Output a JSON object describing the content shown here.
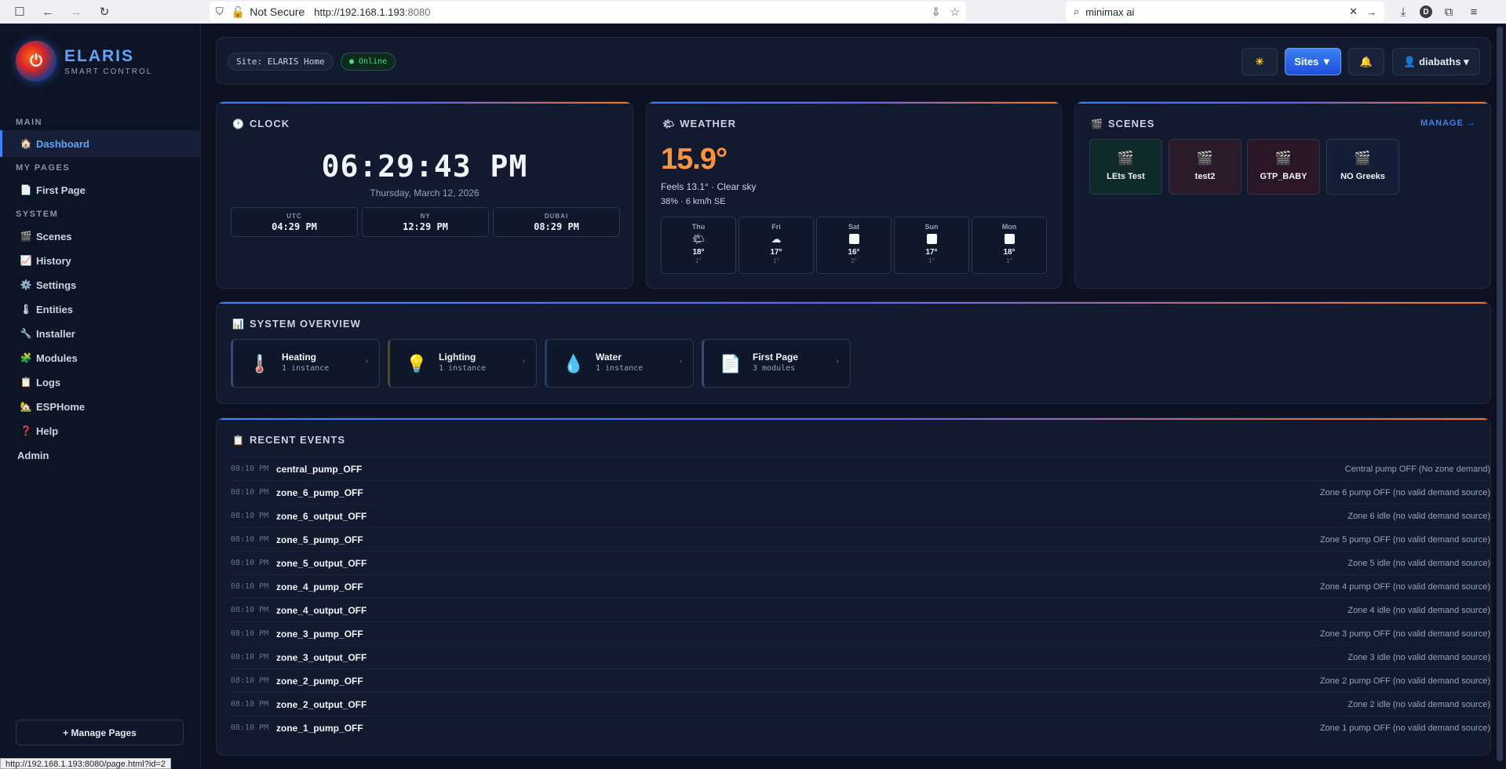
{
  "browser": {
    "security": "Not Secure",
    "url_host": "http://192.168.1.193",
    "url_port": ":8080",
    "search_query": "minimax ai",
    "profile_initial": "D",
    "status_url": "http://192.168.1.193:8080/page.html?id=2"
  },
  "brand": {
    "name": "ELARIS",
    "subtitle": "SMART CONTROL"
  },
  "sidebar": {
    "section_main": "MAIN",
    "section_pages": "MY PAGES",
    "section_system": "SYSTEM",
    "items": [
      {
        "icon": "🏠",
        "label": "Dashboard"
      },
      {
        "icon": "📄",
        "label": "First Page"
      },
      {
        "icon": "🎬",
        "label": "Scenes"
      },
      {
        "icon": "📈",
        "label": "History"
      },
      {
        "icon": "⚙️",
        "label": "Settings"
      },
      {
        "icon": "🌡",
        "label": "Entities"
      },
      {
        "icon": "🔧",
        "label": "Installer"
      },
      {
        "icon": "🧩",
        "label": "Modules"
      },
      {
        "icon": "📋",
        "label": "Logs"
      },
      {
        "icon": "🏡",
        "label": "ESPHome"
      },
      {
        "icon": "❓",
        "label": "Help"
      },
      {
        "icon": "",
        "label": "Admin"
      }
    ],
    "manage_pages": "+ Manage Pages"
  },
  "topbar": {
    "site": "Site: ELARIS Home",
    "status": "● Online",
    "theme_icon": "☀",
    "sites_label": "Sites ▼",
    "bell_icon": "🔔",
    "user_label": "👤 diabaths ▾"
  },
  "clock": {
    "title": "CLOCK",
    "time": "06:29:43 PM",
    "date": "Thursday, March 12, 2026",
    "zones": [
      {
        "label": "UTC",
        "time": "04:29 PM"
      },
      {
        "label": "NY",
        "time": "12:29 PM"
      },
      {
        "label": "DUBAI",
        "time": "08:29 PM"
      }
    ]
  },
  "weather": {
    "title": "WEATHER",
    "temp": "15.9°",
    "feels": "Feels 13.1° · Clear sky",
    "humidity_wind": "38% · 6 km/h SE",
    "forecast": [
      {
        "day": "Thu",
        "icon": "partly-cloudy",
        "glyph": "🌤",
        "high": "18°",
        "low": "1°"
      },
      {
        "day": "Fri",
        "icon": "cloud",
        "glyph": "☁",
        "high": "17°",
        "low": "1°"
      },
      {
        "day": "Sat",
        "icon": "blank",
        "glyph": "",
        "high": "16°",
        "low": "2°"
      },
      {
        "day": "Sun",
        "icon": "blank",
        "glyph": "",
        "high": "17°",
        "low": "1°"
      },
      {
        "day": "Mon",
        "icon": "blank",
        "glyph": "",
        "high": "18°",
        "low": "1°"
      }
    ]
  },
  "scenes": {
    "title": "SCENES",
    "manage": "MANAGE →",
    "items": [
      {
        "name": "LEts Test",
        "color": "#0f2a2a"
      },
      {
        "name": "test2",
        "color": "#2a1a2a"
      },
      {
        "name": "GTP_BABY",
        "color": "#2a1626"
      },
      {
        "name": "NO Greeks",
        "color": "#141d36"
      }
    ]
  },
  "overview": {
    "title": "SYSTEM OVERVIEW",
    "tiles": [
      {
        "icon": "🌡️",
        "name": "Heating",
        "count": "1 instance"
      },
      {
        "icon": "💡",
        "name": "Lighting",
        "count": "1 instance"
      },
      {
        "icon": "💧",
        "name": "Water",
        "count": "1 instance"
      },
      {
        "icon": "📄",
        "name": "First Page",
        "count": "3 modules"
      }
    ]
  },
  "events": {
    "title": "RECENT EVENTS",
    "rows": [
      {
        "time": "08:10 PM",
        "name": "central_pump_OFF",
        "desc": "Central pump OFF (No zone demand)"
      },
      {
        "time": "08:10 PM",
        "name": "zone_6_pump_OFF",
        "desc": "Zone 6 pump OFF (no valid demand source)"
      },
      {
        "time": "08:10 PM",
        "name": "zone_6_output_OFF",
        "desc": "Zone 6 idle (no valid demand source)"
      },
      {
        "time": "08:10 PM",
        "name": "zone_5_pump_OFF",
        "desc": "Zone 5 pump OFF (no valid demand source)"
      },
      {
        "time": "08:10 PM",
        "name": "zone_5_output_OFF",
        "desc": "Zone 5 idle (no valid demand source)"
      },
      {
        "time": "08:10 PM",
        "name": "zone_4_pump_OFF",
        "desc": "Zone 4 pump OFF (no valid demand source)"
      },
      {
        "time": "08:10 PM",
        "name": "zone_4_output_OFF",
        "desc": "Zone 4 idle (no valid demand source)"
      },
      {
        "time": "08:10 PM",
        "name": "zone_3_pump_OFF",
        "desc": "Zone 3 pump OFF (no valid demand source)"
      },
      {
        "time": "08:10 PM",
        "name": "zone_3_output_OFF",
        "desc": "Zone 3 idle (no valid demand source)"
      },
      {
        "time": "08:10 PM",
        "name": "zone_2_pump_OFF",
        "desc": "Zone 2 pump OFF (no valid demand source)"
      },
      {
        "time": "08:10 PM",
        "name": "zone_2_output_OFF",
        "desc": "Zone 2 idle (no valid demand source)"
      },
      {
        "time": "08:10 PM",
        "name": "zone_1_pump_OFF",
        "desc": "Zone 1 pump OFF (no valid demand source)"
      }
    ]
  },
  "colors": {
    "accent": "#3b82f6",
    "orange": "#fb923c",
    "bg": "#0b1120",
    "online": "#4ade80"
  }
}
